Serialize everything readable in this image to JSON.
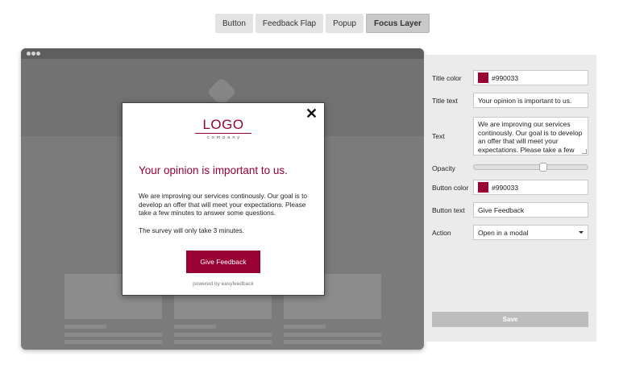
{
  "tabs": [
    {
      "label": "Button"
    },
    {
      "label": "Feedback Flap"
    },
    {
      "label": "Popup"
    },
    {
      "label": "Focus Layer",
      "active": true
    }
  ],
  "modal": {
    "close_symbol": "✕",
    "logo_main": "LOGO",
    "logo_sub": "company",
    "title": "Your opinion is important to us.",
    "text": "We are improving our services continously. Our goal is to develop an offer that will meet your expectations. Please take a few minutes to answer some questions.",
    "note": "The survey will only take 3 minutes.",
    "button_label": "Give Feedback",
    "powered_by": "powered by easyfeedback"
  },
  "settings": {
    "title_color": {
      "label": "Title color",
      "value": "#990033"
    },
    "title_text": {
      "label": "Title text",
      "value": "Your opinion is important to us."
    },
    "text": {
      "label": "Text",
      "value": "We are improving our services continously. Our goal is to develop an offer that will meet your expectations. Please take a few"
    },
    "opacity": {
      "label": "Opacity",
      "level_percent": 62
    },
    "button_color": {
      "label": "Button color",
      "value": "#990033"
    },
    "button_text": {
      "label": "Button text",
      "value": "Give Feedback"
    },
    "action": {
      "label": "Action",
      "value": "Open in a modal"
    },
    "save_label": "Save"
  },
  "colors": {
    "brand": "#990033",
    "save_disabled": "#bdbdbd"
  },
  "icons": {
    "close": "close-icon",
    "dropdown": "chevron-down-icon",
    "window_controls": "window-dots-icon"
  }
}
